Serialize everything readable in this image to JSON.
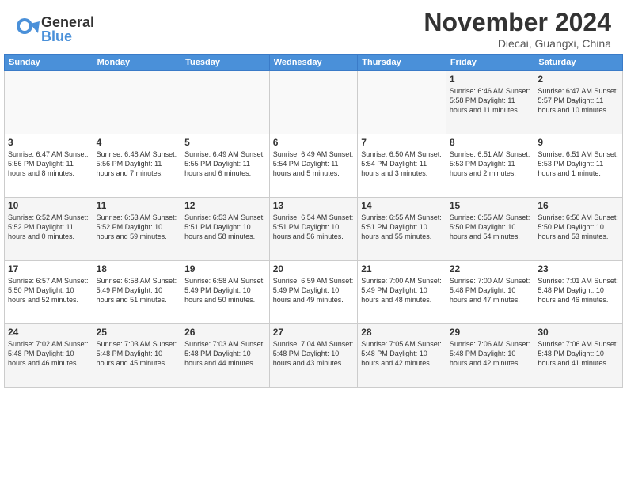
{
  "header": {
    "logo_general": "General",
    "logo_blue": "Blue",
    "month": "November 2024",
    "location": "Diecai, Guangxi, China"
  },
  "weekdays": [
    "Sunday",
    "Monday",
    "Tuesday",
    "Wednesday",
    "Thursday",
    "Friday",
    "Saturday"
  ],
  "weeks": [
    [
      {
        "day": "",
        "info": ""
      },
      {
        "day": "",
        "info": ""
      },
      {
        "day": "",
        "info": ""
      },
      {
        "day": "",
        "info": ""
      },
      {
        "day": "",
        "info": ""
      },
      {
        "day": "1",
        "info": "Sunrise: 6:46 AM\nSunset: 5:58 PM\nDaylight: 11 hours and 11 minutes."
      },
      {
        "day": "2",
        "info": "Sunrise: 6:47 AM\nSunset: 5:57 PM\nDaylight: 11 hours and 10 minutes."
      }
    ],
    [
      {
        "day": "3",
        "info": "Sunrise: 6:47 AM\nSunset: 5:56 PM\nDaylight: 11 hours and 8 minutes."
      },
      {
        "day": "4",
        "info": "Sunrise: 6:48 AM\nSunset: 5:56 PM\nDaylight: 11 hours and 7 minutes."
      },
      {
        "day": "5",
        "info": "Sunrise: 6:49 AM\nSunset: 5:55 PM\nDaylight: 11 hours and 6 minutes."
      },
      {
        "day": "6",
        "info": "Sunrise: 6:49 AM\nSunset: 5:54 PM\nDaylight: 11 hours and 5 minutes."
      },
      {
        "day": "7",
        "info": "Sunrise: 6:50 AM\nSunset: 5:54 PM\nDaylight: 11 hours and 3 minutes."
      },
      {
        "day": "8",
        "info": "Sunrise: 6:51 AM\nSunset: 5:53 PM\nDaylight: 11 hours and 2 minutes."
      },
      {
        "day": "9",
        "info": "Sunrise: 6:51 AM\nSunset: 5:53 PM\nDaylight: 11 hours and 1 minute."
      }
    ],
    [
      {
        "day": "10",
        "info": "Sunrise: 6:52 AM\nSunset: 5:52 PM\nDaylight: 11 hours and 0 minutes."
      },
      {
        "day": "11",
        "info": "Sunrise: 6:53 AM\nSunset: 5:52 PM\nDaylight: 10 hours and 59 minutes."
      },
      {
        "day": "12",
        "info": "Sunrise: 6:53 AM\nSunset: 5:51 PM\nDaylight: 10 hours and 58 minutes."
      },
      {
        "day": "13",
        "info": "Sunrise: 6:54 AM\nSunset: 5:51 PM\nDaylight: 10 hours and 56 minutes."
      },
      {
        "day": "14",
        "info": "Sunrise: 6:55 AM\nSunset: 5:51 PM\nDaylight: 10 hours and 55 minutes."
      },
      {
        "day": "15",
        "info": "Sunrise: 6:55 AM\nSunset: 5:50 PM\nDaylight: 10 hours and 54 minutes."
      },
      {
        "day": "16",
        "info": "Sunrise: 6:56 AM\nSunset: 5:50 PM\nDaylight: 10 hours and 53 minutes."
      }
    ],
    [
      {
        "day": "17",
        "info": "Sunrise: 6:57 AM\nSunset: 5:50 PM\nDaylight: 10 hours and 52 minutes."
      },
      {
        "day": "18",
        "info": "Sunrise: 6:58 AM\nSunset: 5:49 PM\nDaylight: 10 hours and 51 minutes."
      },
      {
        "day": "19",
        "info": "Sunrise: 6:58 AM\nSunset: 5:49 PM\nDaylight: 10 hours and 50 minutes."
      },
      {
        "day": "20",
        "info": "Sunrise: 6:59 AM\nSunset: 5:49 PM\nDaylight: 10 hours and 49 minutes."
      },
      {
        "day": "21",
        "info": "Sunrise: 7:00 AM\nSunset: 5:49 PM\nDaylight: 10 hours and 48 minutes."
      },
      {
        "day": "22",
        "info": "Sunrise: 7:00 AM\nSunset: 5:48 PM\nDaylight: 10 hours and 47 minutes."
      },
      {
        "day": "23",
        "info": "Sunrise: 7:01 AM\nSunset: 5:48 PM\nDaylight: 10 hours and 46 minutes."
      }
    ],
    [
      {
        "day": "24",
        "info": "Sunrise: 7:02 AM\nSunset: 5:48 PM\nDaylight: 10 hours and 46 minutes."
      },
      {
        "day": "25",
        "info": "Sunrise: 7:03 AM\nSunset: 5:48 PM\nDaylight: 10 hours and 45 minutes."
      },
      {
        "day": "26",
        "info": "Sunrise: 7:03 AM\nSunset: 5:48 PM\nDaylight: 10 hours and 44 minutes."
      },
      {
        "day": "27",
        "info": "Sunrise: 7:04 AM\nSunset: 5:48 PM\nDaylight: 10 hours and 43 minutes."
      },
      {
        "day": "28",
        "info": "Sunrise: 7:05 AM\nSunset: 5:48 PM\nDaylight: 10 hours and 42 minutes."
      },
      {
        "day": "29",
        "info": "Sunrise: 7:06 AM\nSunset: 5:48 PM\nDaylight: 10 hours and 42 minutes."
      },
      {
        "day": "30",
        "info": "Sunrise: 7:06 AM\nSunset: 5:48 PM\nDaylight: 10 hours and 41 minutes."
      }
    ]
  ]
}
